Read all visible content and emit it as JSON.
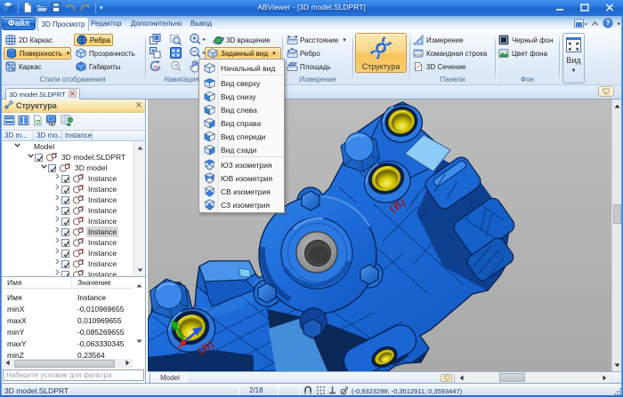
{
  "window": {
    "title": "ABViewer - [3D model.SLDPRT]"
  },
  "tabs": {
    "file": "Файл",
    "items": [
      "3D Просмотр",
      "Редактор",
      "Дополнительно",
      "Вывод"
    ],
    "active": "3D Просмотр"
  },
  "ribbon": {
    "display_styles": {
      "label": "Стили отображения",
      "wireframe2d": "2D Каркас",
      "edges": "Ребра",
      "surface": "Поверхность",
      "transparency": "Прозрачность",
      "wireframe": "Каркас",
      "dimensions": "Габариты"
    },
    "navigation": {
      "label": "Навигация",
      "rotate3d": "3D вращение",
      "named_view": "Заданный вид"
    },
    "measurement": {
      "label": "Измерение",
      "distance": "Расстояние",
      "edge": "Ребро",
      "area": "Площадь"
    },
    "structure": {
      "label": "Структура"
    },
    "panels": {
      "label": "Панели",
      "measurement": "Измерение",
      "command_line": "Командная строка",
      "section3d": "3D Сечение"
    },
    "background": {
      "label": "Фон",
      "black_bg": "Черный фон",
      "bg_color": "Цвет фона"
    },
    "view": {
      "label": "Вид"
    }
  },
  "doc_tab": {
    "label": "3D model.SLDPRT"
  },
  "structure_panel": {
    "title": "Структура",
    "columns": [
      "3D m...",
      "3D mo...",
      "Instance"
    ],
    "tree": [
      {
        "label": "Model",
        "level": 0,
        "exp": "open",
        "checkbox": false,
        "icon": false
      },
      {
        "label": "3D model.SLDPRT",
        "level": 1,
        "exp": "open",
        "checkbox": true,
        "icon": true
      },
      {
        "label": "3D model",
        "level": 2,
        "exp": "open",
        "checkbox": true,
        "icon": true
      },
      {
        "label": "Instance",
        "level": 3,
        "exp": "closed",
        "checkbox": true,
        "icon": true
      },
      {
        "label": "Instance",
        "level": 3,
        "exp": "closed",
        "checkbox": true,
        "icon": true
      },
      {
        "label": "Instance",
        "level": 3,
        "exp": "closed",
        "checkbox": true,
        "icon": true
      },
      {
        "label": "Instance",
        "level": 3,
        "exp": "closed",
        "checkbox": true,
        "icon": true
      },
      {
        "label": "Instance",
        "level": 3,
        "exp": "closed",
        "checkbox": true,
        "icon": true
      },
      {
        "label": "Instance",
        "level": 3,
        "exp": "closed",
        "checkbox": true,
        "icon": true,
        "selected": true
      },
      {
        "label": "Instance",
        "level": 3,
        "exp": "closed",
        "checkbox": true,
        "icon": true
      },
      {
        "label": "Instance",
        "level": 3,
        "exp": "closed",
        "checkbox": true,
        "icon": true
      },
      {
        "label": "Instance",
        "level": 3,
        "exp": "closed",
        "checkbox": true,
        "icon": true
      },
      {
        "label": "Instance",
        "level": 3,
        "exp": "closed",
        "checkbox": true,
        "icon": true
      }
    ],
    "properties": {
      "headers": [
        "Имя",
        "Значение"
      ],
      "rows": [
        [
          "Имя",
          "Instance"
        ],
        [
          "minX",
          "-0,010969655"
        ],
        [
          "maxX",
          "0,010969655"
        ],
        [
          "minY",
          "-0,085269655"
        ],
        [
          "maxY",
          "-0,063330345"
        ],
        [
          "minZ",
          "0,23564"
        ]
      ]
    },
    "filter_placeholder": "Наберите условие для фильтра"
  },
  "view_menu": {
    "items": [
      {
        "label": "Начальный вид",
        "icon": "cube-home",
        "sep_after": true
      },
      {
        "label": "Вид сверху",
        "icon": "cube-top"
      },
      {
        "label": "Вид снизу",
        "icon": "cube-bottom"
      },
      {
        "label": "Вид слева",
        "icon": "cube-left"
      },
      {
        "label": "Вид справа",
        "icon": "cube-right"
      },
      {
        "label": "Вид спереди",
        "icon": "cube-front"
      },
      {
        "label": "Вид сзади",
        "icon": "cube-back",
        "sep_after": true
      },
      {
        "label": "ЮЗ изометрия",
        "icon": "iso-sw"
      },
      {
        "label": "ЮВ изометрия",
        "icon": "iso-se"
      },
      {
        "label": "СВ изометрия",
        "icon": "iso-ne"
      },
      {
        "label": "СЗ изометрия",
        "icon": "iso-nw"
      }
    ]
  },
  "viewport": {
    "sheet_tab": "Model",
    "labels": [
      "(B)",
      "(B)"
    ],
    "model_color": "#1c6ad8",
    "insert_color": "#d8ca00",
    "selected_face_color": "#8ecbf6",
    "annotation_color": "#a01613",
    "background_gray": "#b3b3b3",
    "axis_colors": {
      "x": "#e02020",
      "y": "#18aa10",
      "z": "#2a52e0"
    }
  },
  "colors": {
    "titlebar_blue": "#2b7ae2",
    "ribbon_background": "#e7f0fa",
    "highlight_orange": "#fbd387",
    "highlight_border": "#c79238",
    "panel_header_yellow": "#fae7ac",
    "statusbar_blue": "#dce9f6"
  },
  "icons": [
    "app-icon",
    "new-file-icon",
    "open-file-icon",
    "save-icon",
    "undo-icon",
    "redo-icon",
    "minimize-icon",
    "maximize-icon",
    "close-icon",
    "help-icon",
    "wireframe-2d-icon",
    "edges-icon",
    "surface-icon",
    "transparency-icon",
    "wireframe-icon",
    "dimensions-icon",
    "pan-views-icon",
    "zoom-window-icon",
    "zoom-in-icon",
    "previous-view-icon",
    "zoom-extents-icon",
    "zoom-out-icon",
    "rotate-35-icon",
    "zoom-previous-icon",
    "pan-hand-icon",
    "rotate-3d-icon",
    "named-view-cube-icon",
    "distance-icon",
    "edge-icon",
    "area-icon",
    "structure-dna-icon",
    "measurement-panel-icon",
    "command-line-icon",
    "section-3d-icon",
    "black-background-icon",
    "background-color-icon",
    "view-expand-icon",
    "structure-panel-icon",
    "rows-layout-icon",
    "columns-layout-icon",
    "refresh-document-icon",
    "visibility-icon",
    "export-structure-icon",
    "component-icon",
    "checkbox-icon",
    "cube-home",
    "cube-top",
    "cube-bottom",
    "cube-left",
    "cube-right",
    "cube-front",
    "cube-back",
    "iso-sw",
    "iso-se",
    "iso-ne",
    "iso-nw",
    "snap-magnet-icon",
    "grid-snap-icon",
    "ortho-mode-icon",
    "polar-tracking-icon",
    "heart-collapse-icon",
    "resize-grip-icon"
  ],
  "statusbar": {
    "file": "3D model.SLDPRT",
    "page": "2/18",
    "coords": "(-0,9323298; -0,3512911; 0,3593447)"
  }
}
